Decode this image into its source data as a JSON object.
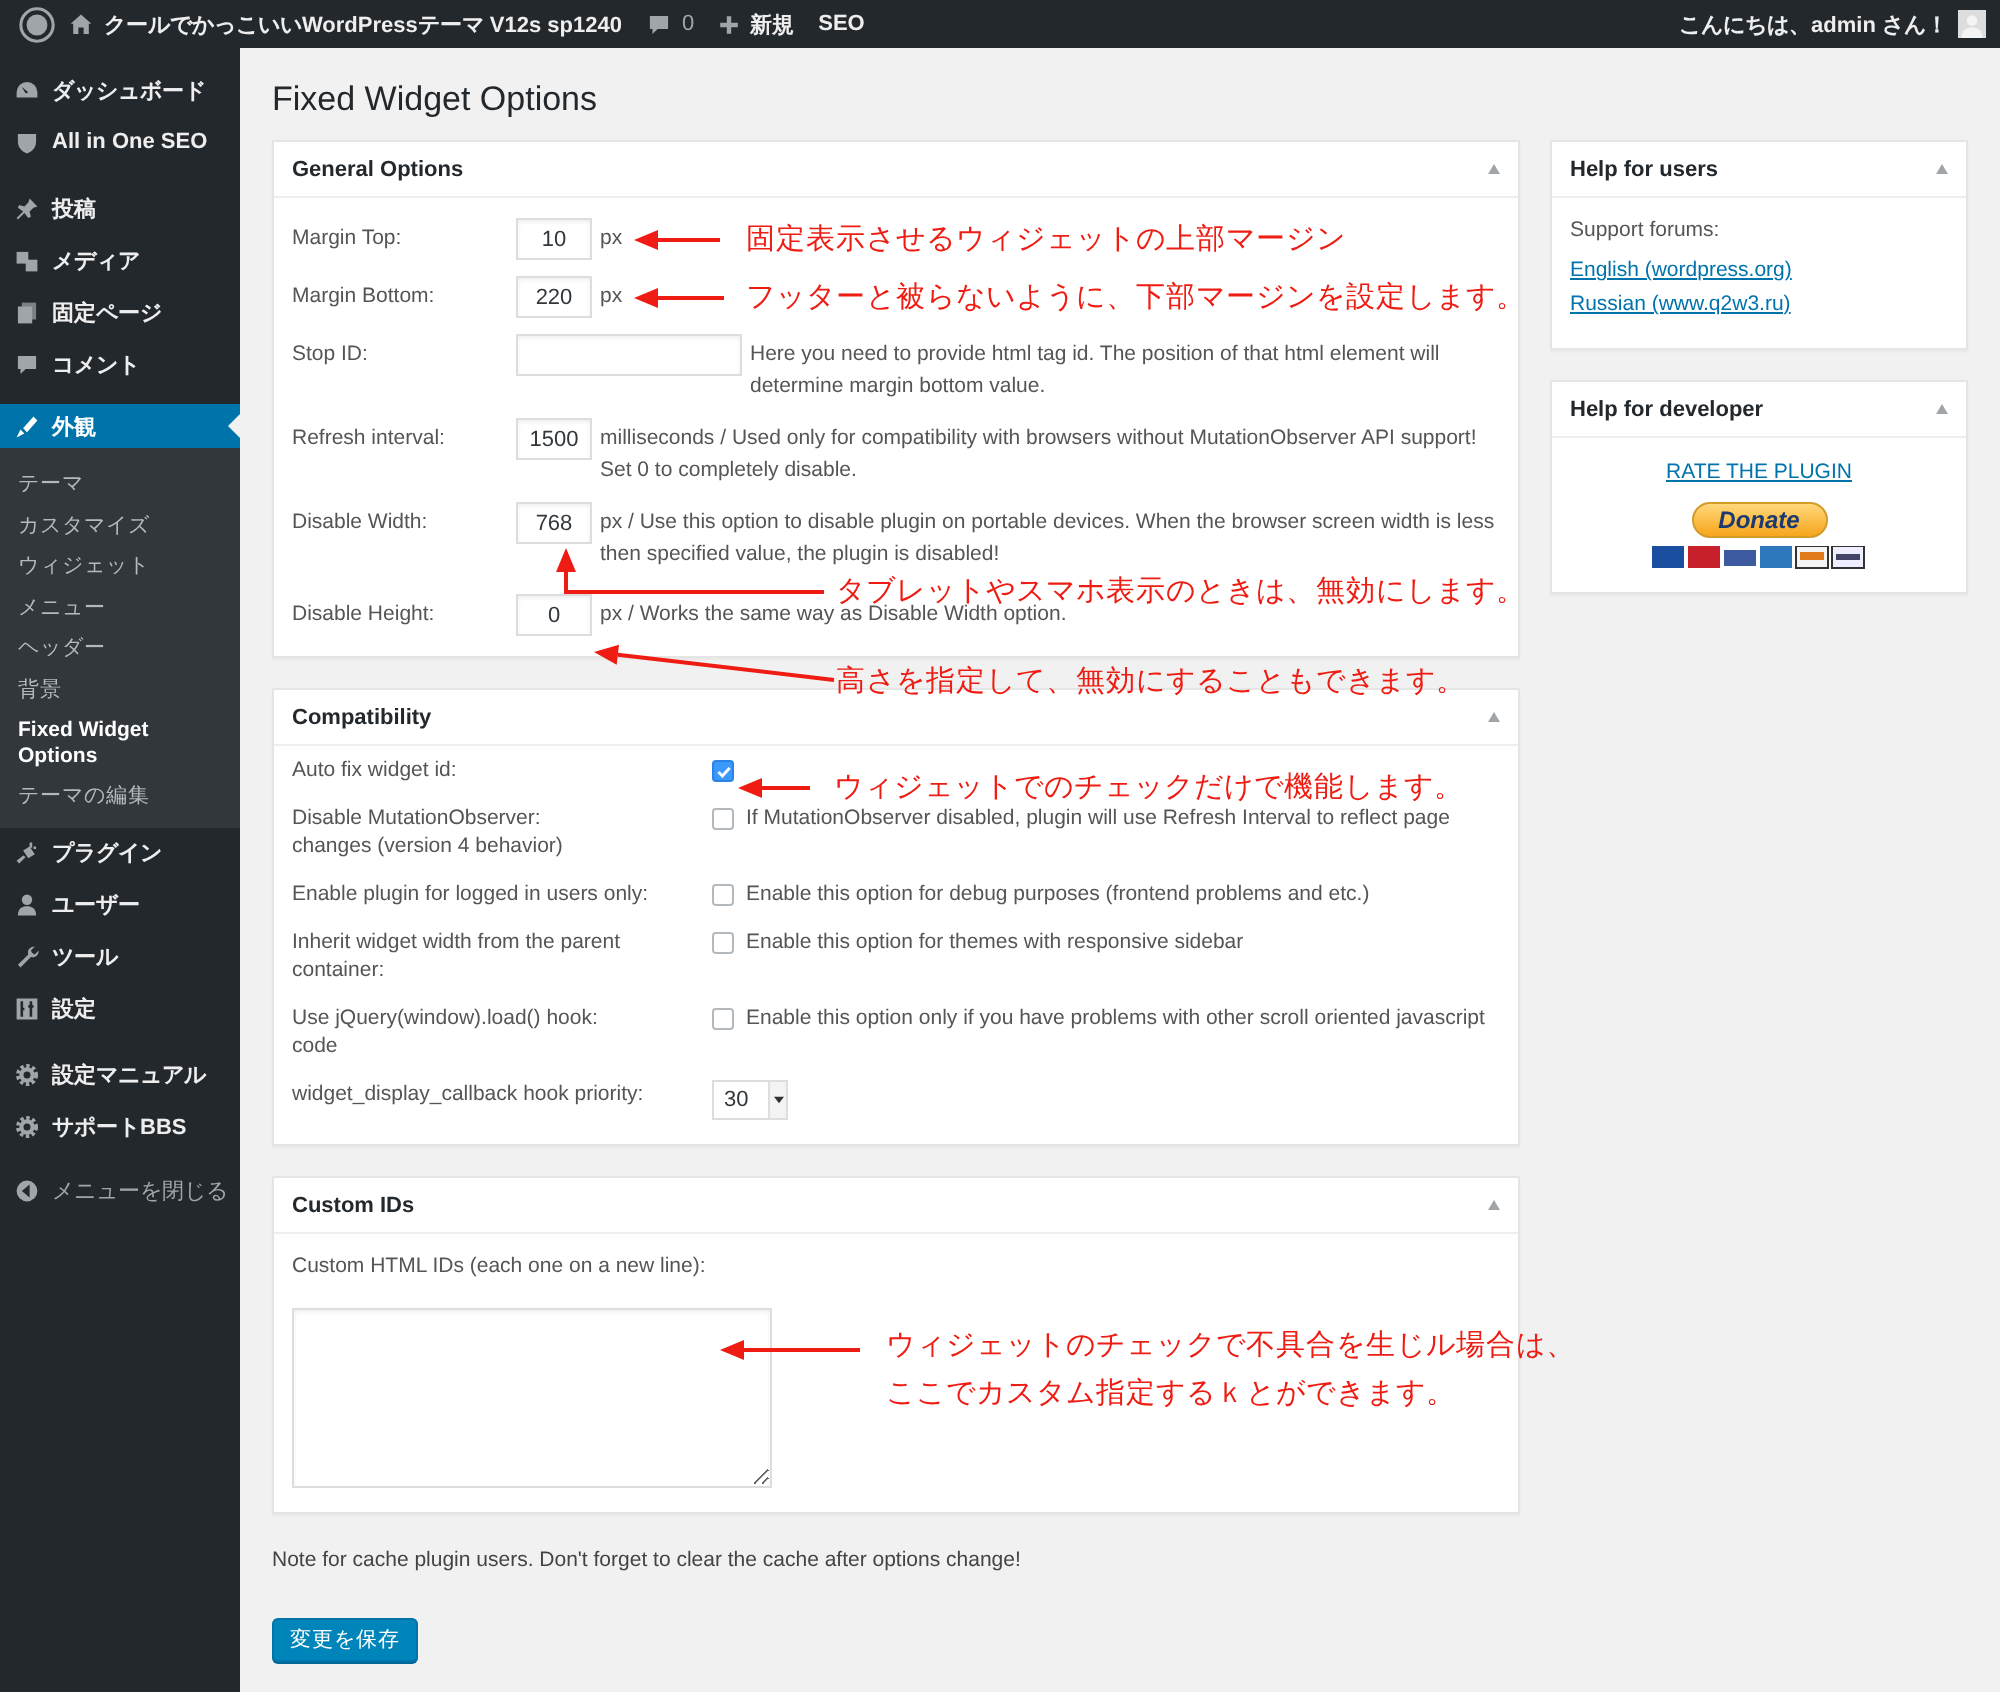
{
  "admin_bar": {
    "site_title": "クールでかっこいいWordPressテーマ V12s sp1240",
    "comment_count": "0",
    "new_label": "新規",
    "seo_label": "SEO",
    "greeting": "こんにちは、admin さん！"
  },
  "sidebar": {
    "groups": [
      {
        "items": [
          {
            "label": "ダッシュボード",
            "selected": false
          },
          {
            "label": "All in One SEO",
            "selected": false
          }
        ]
      },
      {
        "items": [
          {
            "label": "投稿",
            "selected": false
          },
          {
            "label": "メディア",
            "selected": false
          },
          {
            "label": "固定ページ",
            "selected": false
          },
          {
            "label": "コメント",
            "selected": false
          }
        ]
      },
      {
        "items": [
          {
            "label": "外観",
            "selected": true,
            "submenu": [
              {
                "label": "テーマ",
                "selected": false
              },
              {
                "label": "カスタマイズ",
                "selected": false
              },
              {
                "label": "ウィジェット",
                "selected": false
              },
              {
                "label": "メニュー",
                "selected": false
              },
              {
                "label": "ヘッダー",
                "selected": false
              },
              {
                "label": "背景",
                "selected": false
              },
              {
                "label": "Fixed Widget Options",
                "selected": true
              },
              {
                "label": "テーマの編集",
                "selected": false
              }
            ]
          },
          {
            "label": "プラグイン",
            "selected": false
          },
          {
            "label": "ユーザー",
            "selected": false
          },
          {
            "label": "ツール",
            "selected": false
          },
          {
            "label": "設定",
            "selected": false
          }
        ]
      },
      {
        "items": [
          {
            "label": "設定マニュアル",
            "selected": false
          },
          {
            "label": "サポートBBS",
            "selected": false
          }
        ]
      }
    ],
    "collapse_label": "メニューを閉じる"
  },
  "page_title": "Fixed Widget Options",
  "general_options": {
    "title": "General Options",
    "rows": [
      {
        "kind": "number",
        "label": "Margin Top:",
        "value": "10",
        "note": "px"
      },
      {
        "kind": "number",
        "label": "Margin Bottom:",
        "value": "220",
        "note": "px"
      },
      {
        "kind": "text",
        "label": "Stop ID:",
        "note": "Here you need to provide html tag id. The position of that html element will determine margin bottom value."
      },
      {
        "kind": "number",
        "label": "Refresh interval:",
        "value": "1500",
        "note": "milliseconds / Used only for compatibility with browsers without MutationObserver API support! Set 0 to completely disable."
      },
      {
        "kind": "number",
        "label": "Disable Width:",
        "value": "768",
        "note": "px / Use this option to disable plugin on portable devices. When the browser screen width is less then specified value, the plugin is disabled!"
      },
      {
        "kind": "number",
        "label": "Disable Height:",
        "value": "0",
        "note": "px / Works the same way as Disable Width option."
      }
    ]
  },
  "compatibility": {
    "title": "Compatibility",
    "rows": [
      {
        "kind": "checkbox",
        "label": "Auto fix widget id:",
        "checked": true
      },
      {
        "kind": "checkbox",
        "label": "Disable MutationObserver:\nchanges (version 4 behavior)",
        "checked": false,
        "note": "If MutationObserver disabled, plugin will use Refresh Interval to reflect page"
      },
      {
        "kind": "checkbox",
        "label": "Enable plugin for logged in users only:",
        "checked": false,
        "note": "Enable this option for debug purposes (frontend problems and etc.)"
      },
      {
        "kind": "checkbox",
        "label": "Inherit widget width from the parent\ncontainer:",
        "checked": false,
        "note": "Enable this option for themes with responsive sidebar"
      },
      {
        "kind": "checkbox",
        "label": "Use jQuery(window).load() hook:\ncode",
        "checked": false,
        "note": "Enable this option only if you have problems with other scroll oriented javascript"
      },
      {
        "kind": "select",
        "label": "widget_display_callback hook priority:",
        "value": "30"
      }
    ]
  },
  "custom_ids": {
    "title": "Custom IDs",
    "label": "Custom HTML IDs (each one on a new line):"
  },
  "cache_note": "Note for cache plugin users. Don't forget to clear the cache after options change!",
  "save_button": "変更を保存",
  "help_for_users": {
    "title": "Help for users",
    "text": "Support forums:",
    "links": [
      "English (wordpress.org)",
      "Russian (www.q2w3.ru)"
    ]
  },
  "help_for_developer": {
    "title": "Help for developer",
    "link": "RATE THE PLUGIN",
    "donate_button": "Donate"
  },
  "annotations": [
    {
      "lines": [
        "固定表示させるウィジェットの上部マージン"
      ]
    },
    {
      "lines": [
        "フッターと被らないように、下部マージンを設定します。"
      ]
    },
    {
      "lines": [
        "タブレットやスマホ表示のときは、無効にします。"
      ]
    },
    {
      "lines": [
        "高さを指定して、無効にすることもできます。"
      ]
    },
    {
      "lines": [
        "ウィジェットでのチェックだけで機能します。"
      ]
    },
    {
      "lines": [
        "ウィジェットのチェックで不具合を生じル場合は、",
        "ここでカスタム指定するｋとができます。"
      ]
    }
  ]
}
